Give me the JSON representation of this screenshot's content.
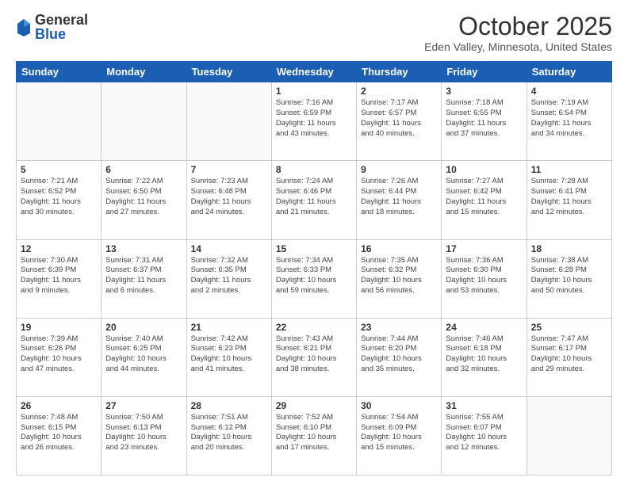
{
  "header": {
    "logo_general": "General",
    "logo_blue": "Blue",
    "title": "October 2025",
    "subtitle": "Eden Valley, Minnesota, United States"
  },
  "days_of_week": [
    "Sunday",
    "Monday",
    "Tuesday",
    "Wednesday",
    "Thursday",
    "Friday",
    "Saturday"
  ],
  "weeks": [
    [
      {
        "num": "",
        "info": ""
      },
      {
        "num": "",
        "info": ""
      },
      {
        "num": "",
        "info": ""
      },
      {
        "num": "1",
        "info": "Sunrise: 7:16 AM\nSunset: 6:59 PM\nDaylight: 11 hours\nand 43 minutes."
      },
      {
        "num": "2",
        "info": "Sunrise: 7:17 AM\nSunset: 6:57 PM\nDaylight: 11 hours\nand 40 minutes."
      },
      {
        "num": "3",
        "info": "Sunrise: 7:18 AM\nSunset: 6:55 PM\nDaylight: 11 hours\nand 37 minutes."
      },
      {
        "num": "4",
        "info": "Sunrise: 7:19 AM\nSunset: 6:54 PM\nDaylight: 11 hours\nand 34 minutes."
      }
    ],
    [
      {
        "num": "5",
        "info": "Sunrise: 7:21 AM\nSunset: 6:52 PM\nDaylight: 11 hours\nand 30 minutes."
      },
      {
        "num": "6",
        "info": "Sunrise: 7:22 AM\nSunset: 6:50 PM\nDaylight: 11 hours\nand 27 minutes."
      },
      {
        "num": "7",
        "info": "Sunrise: 7:23 AM\nSunset: 6:48 PM\nDaylight: 11 hours\nand 24 minutes."
      },
      {
        "num": "8",
        "info": "Sunrise: 7:24 AM\nSunset: 6:46 PM\nDaylight: 11 hours\nand 21 minutes."
      },
      {
        "num": "9",
        "info": "Sunrise: 7:26 AM\nSunset: 6:44 PM\nDaylight: 11 hours\nand 18 minutes."
      },
      {
        "num": "10",
        "info": "Sunrise: 7:27 AM\nSunset: 6:42 PM\nDaylight: 11 hours\nand 15 minutes."
      },
      {
        "num": "11",
        "info": "Sunrise: 7:28 AM\nSunset: 6:41 PM\nDaylight: 11 hours\nand 12 minutes."
      }
    ],
    [
      {
        "num": "12",
        "info": "Sunrise: 7:30 AM\nSunset: 6:39 PM\nDaylight: 11 hours\nand 9 minutes."
      },
      {
        "num": "13",
        "info": "Sunrise: 7:31 AM\nSunset: 6:37 PM\nDaylight: 11 hours\nand 6 minutes."
      },
      {
        "num": "14",
        "info": "Sunrise: 7:32 AM\nSunset: 6:35 PM\nDaylight: 11 hours\nand 2 minutes."
      },
      {
        "num": "15",
        "info": "Sunrise: 7:34 AM\nSunset: 6:33 PM\nDaylight: 10 hours\nand 59 minutes."
      },
      {
        "num": "16",
        "info": "Sunrise: 7:35 AM\nSunset: 6:32 PM\nDaylight: 10 hours\nand 56 minutes."
      },
      {
        "num": "17",
        "info": "Sunrise: 7:36 AM\nSunset: 6:30 PM\nDaylight: 10 hours\nand 53 minutes."
      },
      {
        "num": "18",
        "info": "Sunrise: 7:38 AM\nSunset: 6:28 PM\nDaylight: 10 hours\nand 50 minutes."
      }
    ],
    [
      {
        "num": "19",
        "info": "Sunrise: 7:39 AM\nSunset: 6:26 PM\nDaylight: 10 hours\nand 47 minutes."
      },
      {
        "num": "20",
        "info": "Sunrise: 7:40 AM\nSunset: 6:25 PM\nDaylight: 10 hours\nand 44 minutes."
      },
      {
        "num": "21",
        "info": "Sunrise: 7:42 AM\nSunset: 6:23 PM\nDaylight: 10 hours\nand 41 minutes."
      },
      {
        "num": "22",
        "info": "Sunrise: 7:43 AM\nSunset: 6:21 PM\nDaylight: 10 hours\nand 38 minutes."
      },
      {
        "num": "23",
        "info": "Sunrise: 7:44 AM\nSunset: 6:20 PM\nDaylight: 10 hours\nand 35 minutes."
      },
      {
        "num": "24",
        "info": "Sunrise: 7:46 AM\nSunset: 6:18 PM\nDaylight: 10 hours\nand 32 minutes."
      },
      {
        "num": "25",
        "info": "Sunrise: 7:47 AM\nSunset: 6:17 PM\nDaylight: 10 hours\nand 29 minutes."
      }
    ],
    [
      {
        "num": "26",
        "info": "Sunrise: 7:48 AM\nSunset: 6:15 PM\nDaylight: 10 hours\nand 26 minutes."
      },
      {
        "num": "27",
        "info": "Sunrise: 7:50 AM\nSunset: 6:13 PM\nDaylight: 10 hours\nand 23 minutes."
      },
      {
        "num": "28",
        "info": "Sunrise: 7:51 AM\nSunset: 6:12 PM\nDaylight: 10 hours\nand 20 minutes."
      },
      {
        "num": "29",
        "info": "Sunrise: 7:52 AM\nSunset: 6:10 PM\nDaylight: 10 hours\nand 17 minutes."
      },
      {
        "num": "30",
        "info": "Sunrise: 7:54 AM\nSunset: 6:09 PM\nDaylight: 10 hours\nand 15 minutes."
      },
      {
        "num": "31",
        "info": "Sunrise: 7:55 AM\nSunset: 6:07 PM\nDaylight: 10 hours\nand 12 minutes."
      },
      {
        "num": "",
        "info": ""
      }
    ]
  ]
}
